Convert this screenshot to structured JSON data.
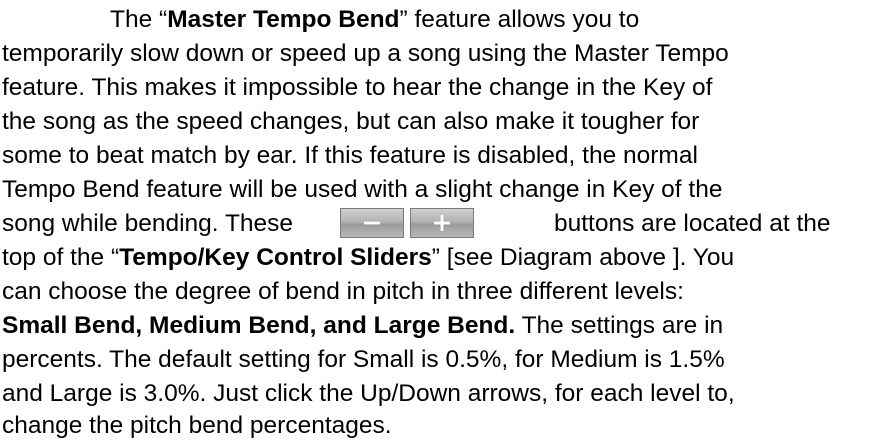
{
  "paragraph": {
    "line1": {
      "pre": "The “",
      "bold": "Master Tempo Bend",
      "post": "” feature allows you to"
    },
    "line2": "temporarily slow down or speed up a song using the Master Tempo",
    "line3": "feature.  This makes it impossible to hear the change in the Key of",
    "line4": "the song as the speed changes, but can also make it tougher for",
    "line5": "some to beat match by ear.  If this feature is disabled, the normal",
    "line6": "Tempo Bend feature will be used with a slight change in Key of the",
    "line7": {
      "pre": "song while bending. These",
      "post": "buttons are located at the"
    },
    "line8": {
      "pre": "top of the “",
      "bold": "Tempo/Key Control Sliders",
      "post": "” [see Diagram above ]. You"
    },
    "line9": "can choose the degree of bend in pitch in three different levels:",
    "line10": {
      "bold": "Small Bend, Medium Bend, and Large Bend.",
      "post": " The settings are in"
    },
    "line11": "percents.  The default setting for Small is 0.5%, for Medium is  1.5%",
    "line12": "and Large is 3.0%. Just click the Up/Down arrows, for each level to,",
    "line13": "change the pitch bend percentages."
  },
  "buttons": {
    "minus_glyph": "−",
    "plus_glyph": "+"
  }
}
